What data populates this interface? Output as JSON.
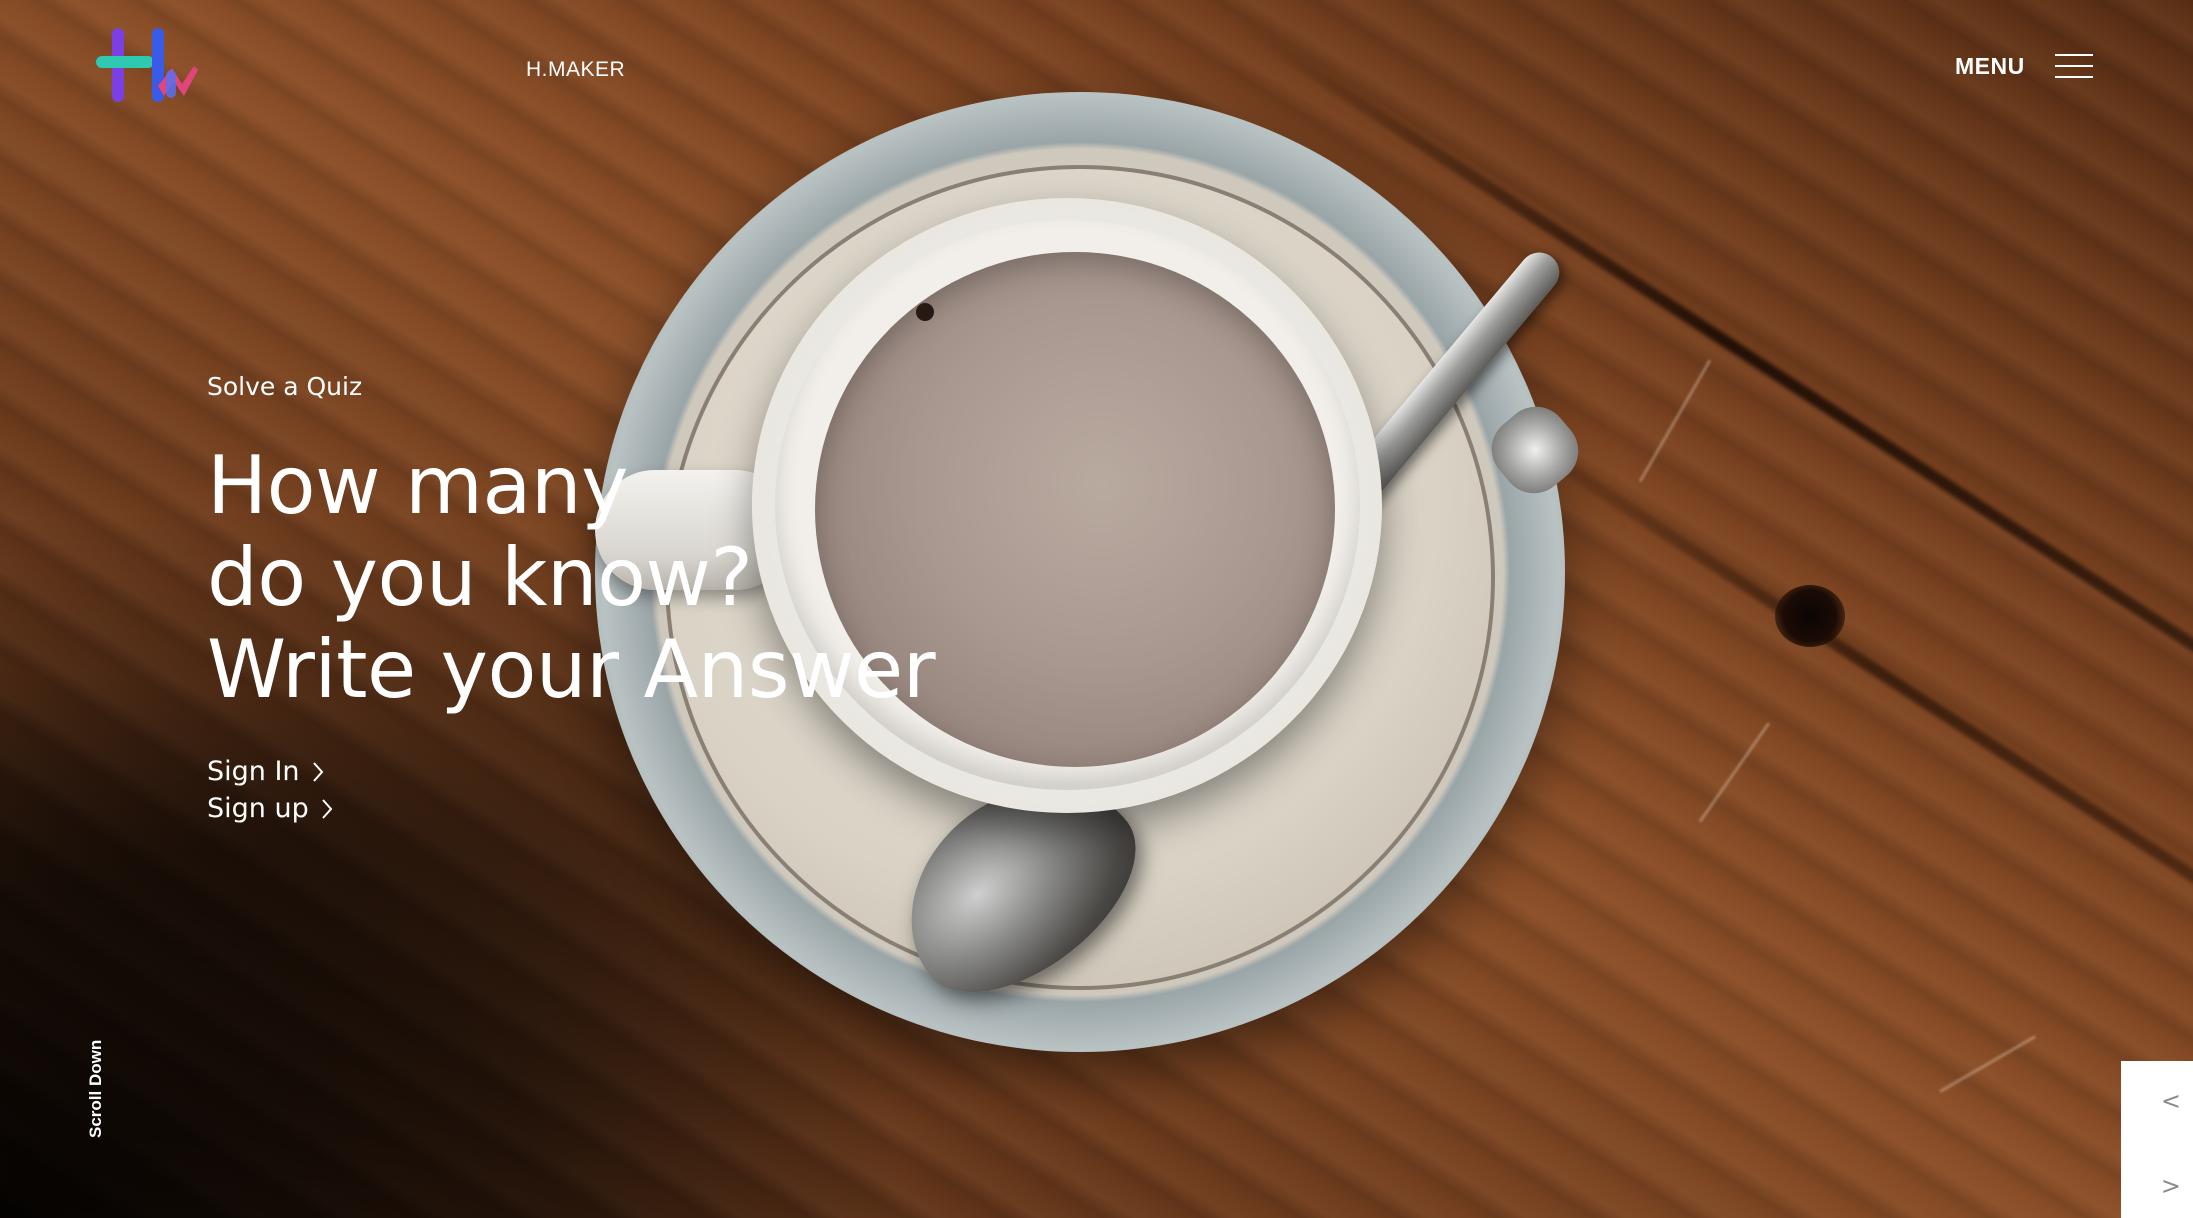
{
  "header": {
    "brand_name": "H.MAKER",
    "menu_label": "MENU",
    "logo_colors": [
      "#7b3fe4",
      "#2fc8b0",
      "#3a5be8",
      "#e0457b"
    ]
  },
  "hero": {
    "eyebrow": "Solve a Quiz",
    "headline_lines": [
      "How many",
      "do you know?",
      "Write your Answer"
    ],
    "links": {
      "sign_in": "Sign In",
      "sign_up": "Sign up"
    }
  },
  "scroll_hint": "Scroll Down",
  "slider": {
    "prev_label": "<",
    "next_label": ">"
  },
  "icons": {
    "menu": "hamburger-icon",
    "link_arrow": "chevron-right-icon"
  }
}
